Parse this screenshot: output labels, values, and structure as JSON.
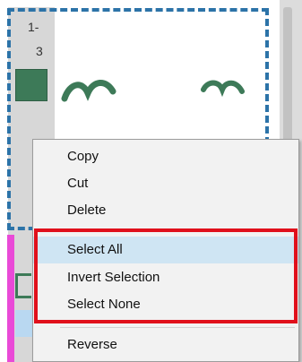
{
  "gutter": {
    "label_top": "1-",
    "label_bottom": "3"
  },
  "colors": {
    "selection_border": "#2c73a8",
    "waveform": "#3d7a58",
    "menu_background": "#f2f2f2",
    "menu_highlight": "#cfe5f3",
    "annotation_box": "#e0101b",
    "magenta_marker": "#e94ad7"
  },
  "context_menu": {
    "items": [
      {
        "label": "Copy"
      },
      {
        "label": "Cut"
      },
      {
        "label": "Delete"
      },
      {
        "label": "Select All",
        "highlighted": true
      },
      {
        "label": "Invert Selection"
      },
      {
        "label": "Select None"
      },
      {
        "label": "Reverse"
      }
    ]
  }
}
